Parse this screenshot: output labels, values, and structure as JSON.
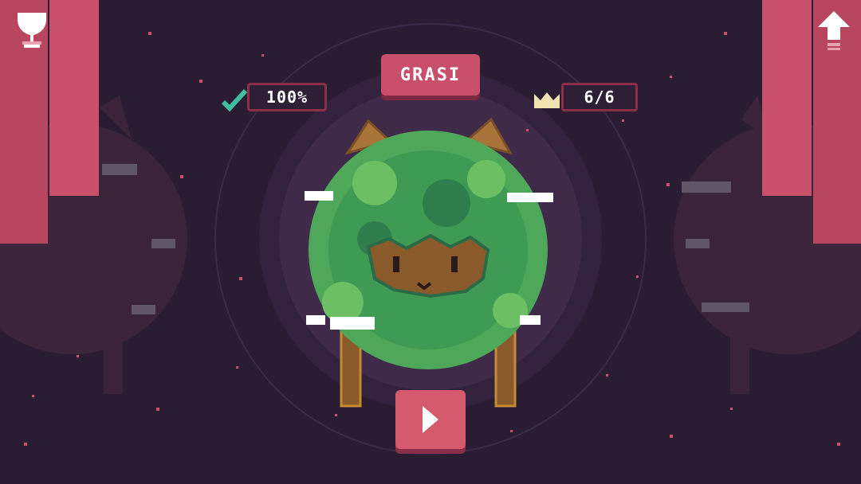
{
  "level": {
    "name": "GRASI",
    "completion": "100%",
    "crowns": "6/6"
  },
  "icons": {
    "trophy": "trophy-icon",
    "upgrade": "arrow-up-icon",
    "check": "check-icon",
    "crown": "crown-icon",
    "play": "play-icon"
  },
  "colors": {
    "background": "#2a1c33",
    "accent": "#c9506a",
    "panel": "#b8465e",
    "check": "#3fbf9f",
    "crown": "#f2e3b3",
    "grass": "#4fa85a"
  }
}
